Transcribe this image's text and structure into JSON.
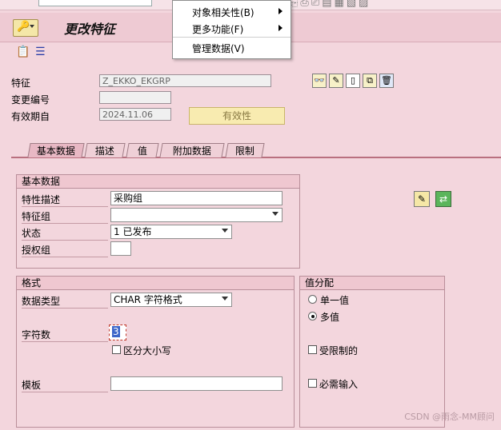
{
  "title": "更改特征",
  "menu": {
    "items": [
      {
        "label": "对象相关性(B)",
        "submenu": true
      },
      {
        "label": "更多功能(F)",
        "submenu": true
      },
      {
        "label": "管理数据(V)",
        "submenu": false
      }
    ]
  },
  "header": {
    "characteristic_label": "特征",
    "characteristic_value": "Z_EKKO_EKGRP",
    "change_number_label": "变更编号",
    "change_number_value": "",
    "valid_from_label": "有效期自",
    "valid_from_value": "2024.11.06",
    "validity_button": "有效性"
  },
  "tabs": [
    {
      "label": "基本数据",
      "active": true
    },
    {
      "label": "描述",
      "active": false
    },
    {
      "label": "值",
      "active": false
    },
    {
      "label": "附加数据",
      "active": false
    },
    {
      "label": "限制",
      "active": false
    }
  ],
  "basic": {
    "group_title": "基本数据",
    "description_label": "特性描述",
    "description_value": "采购组",
    "group_label": "特征组",
    "group_value": "",
    "status_label": "状态",
    "status_value": "1 已发布",
    "auth_label": "授权组",
    "auth_value": ""
  },
  "format": {
    "group_title": "格式",
    "datatype_label": "数据类型",
    "datatype_value": "CHAR 字符格式",
    "chars_label": "字符数",
    "chars_value": "3",
    "case_label": "区分大小写",
    "template_label": "模板",
    "template_value": ""
  },
  "value_assign": {
    "group_title": "值分配",
    "single_label": "单一值",
    "multi_label": "多值",
    "selected": "multi",
    "restricted_label": "受限制的",
    "required_label": "必需输入"
  },
  "watermark": "CSDN @雨念-MM顾问",
  "colors": {
    "background": "#f3d6dd",
    "accent": "#b9707f",
    "button_yellow": "#f8ebb0"
  }
}
